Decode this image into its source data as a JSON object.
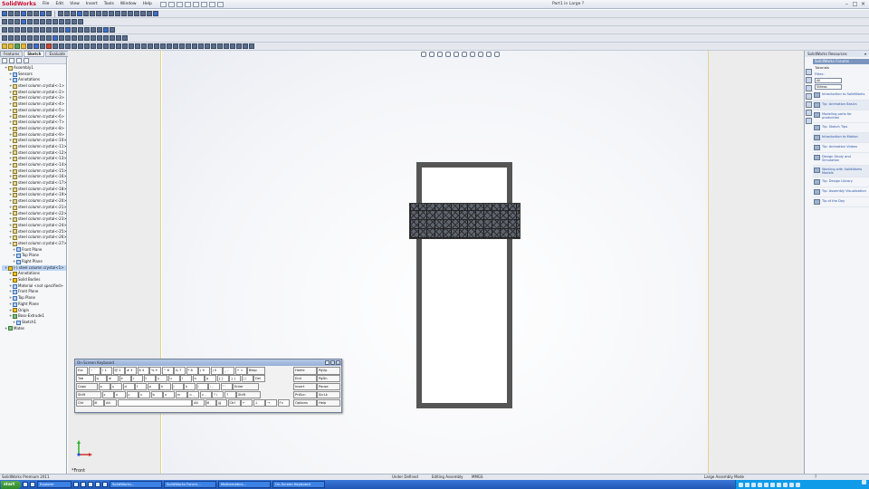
{
  "app": {
    "logo": "SolidWorks",
    "document_title": "Part1 in Large ?",
    "menus": [
      "File",
      "Edit",
      "View",
      "Insert",
      "Tools",
      "Window",
      "Help"
    ]
  },
  "command_tabs": [
    "Features",
    "Sketch",
    "Evaluate",
    "DimXpert",
    "Office Products",
    "Tab",
    "Tab",
    "Tab",
    "Tab",
    "Tab",
    "Tab",
    "Tab",
    "Tab",
    "Tab"
  ],
  "feature_tree": {
    "rows": [
      {
        "label": "Assembly1",
        "depth": 0,
        "icon": "part"
      },
      {
        "label": "Sensors",
        "depth": 1,
        "icon": "plane"
      },
      {
        "label": "Annotations",
        "depth": 1,
        "icon": "plane"
      },
      {
        "label": "steel column crystal<-1>",
        "depth": 1,
        "icon": "part"
      },
      {
        "label": "steel column crystal<-2>",
        "depth": 1,
        "icon": "part"
      },
      {
        "label": "steel column crystal<-3>",
        "depth": 1,
        "icon": "part"
      },
      {
        "label": "steel column crystal<-4>",
        "depth": 1,
        "icon": "part"
      },
      {
        "label": "steel column crystal<-5>",
        "depth": 1,
        "icon": "part"
      },
      {
        "label": "steel column crystal<-6>",
        "depth": 1,
        "icon": "part"
      },
      {
        "label": "steel column crystal<-7>",
        "depth": 1,
        "icon": "part"
      },
      {
        "label": "steel column crystal<-8>",
        "depth": 1,
        "icon": "part"
      },
      {
        "label": "steel column crystal<-9>",
        "depth": 1,
        "icon": "part"
      },
      {
        "label": "steel column crystal<-10>",
        "depth": 1,
        "icon": "part"
      },
      {
        "label": "steel column crystal<-11>",
        "depth": 1,
        "icon": "part"
      },
      {
        "label": "steel column crystal<-12>",
        "depth": 1,
        "icon": "part"
      },
      {
        "label": "steel column crystal<-13>",
        "depth": 1,
        "icon": "part"
      },
      {
        "label": "steel column crystal<-14>",
        "depth": 1,
        "icon": "part"
      },
      {
        "label": "steel column crystal<-15>",
        "depth": 1,
        "icon": "part"
      },
      {
        "label": "steel column crystal<-16>",
        "depth": 1,
        "icon": "part"
      },
      {
        "label": "steel column crystal<-17>",
        "depth": 1,
        "icon": "part"
      },
      {
        "label": "steel column crystal<-18>",
        "depth": 1,
        "icon": "part"
      },
      {
        "label": "steel column crystal<-19>",
        "depth": 1,
        "icon": "part"
      },
      {
        "label": "steel column crystal<-20>",
        "depth": 1,
        "icon": "part"
      },
      {
        "label": "steel column crystal<-21>",
        "depth": 1,
        "icon": "part"
      },
      {
        "label": "steel column crystal<-22>",
        "depth": 1,
        "icon": "part"
      },
      {
        "label": "steel column crystal<-23>",
        "depth": 1,
        "icon": "part"
      },
      {
        "label": "steel column crystal<-24>",
        "depth": 1,
        "icon": "part"
      },
      {
        "label": "steel column crystal<-25>",
        "depth": 1,
        "icon": "part"
      },
      {
        "label": "steel column crystal<-26>",
        "depth": 1,
        "icon": "part"
      },
      {
        "label": "steel column crystal<-27>",
        "depth": 1,
        "icon": "part"
      },
      {
        "label": "Front Plane",
        "depth": 2,
        "icon": "plane"
      },
      {
        "label": "Top Plane",
        "depth": 2,
        "icon": "plane"
      },
      {
        "label": "Right Plane",
        "depth": 2,
        "icon": "plane"
      },
      {
        "label": "(-) steel column crystal<1>",
        "depth": 0,
        "icon": "warn",
        "selected": true
      },
      {
        "label": "Annotations",
        "depth": 1,
        "icon": "warn"
      },
      {
        "label": "Solid Bodies",
        "depth": 1,
        "icon": "warn"
      },
      {
        "label": "Material <not specified>",
        "depth": 1,
        "icon": "plane"
      },
      {
        "label": "Front Plane",
        "depth": 1,
        "icon": "plane"
      },
      {
        "label": "Top Plane",
        "depth": 1,
        "icon": "plane"
      },
      {
        "label": "Right Plane",
        "depth": 1,
        "icon": "plane"
      },
      {
        "label": "Origin",
        "depth": 1,
        "icon": "warn"
      },
      {
        "label": "Boss-Extrude1",
        "depth": 1,
        "icon": "mate"
      },
      {
        "label": "Sketch1",
        "depth": 2,
        "icon": "plane"
      },
      {
        "label": "Mates",
        "depth": 0,
        "icon": "mate"
      }
    ]
  },
  "viewport": {
    "view_label": "*Front"
  },
  "keyboard": {
    "title": "On-Screen Keyboard",
    "rows": [
      [
        "Esc",
        "~ `",
        "! 1",
        "@ 2",
        "# 3",
        "$ 4",
        "% 5",
        "^ 6",
        "& 7",
        "* 8",
        "( 9",
        ") 0",
        "_ -",
        "+ =",
        "Bksp"
      ],
      [
        "Tab",
        "q",
        "w",
        "e",
        "r",
        "t",
        "y",
        "u",
        "i",
        "o",
        "p",
        "{ [",
        "} ]",
        "| \\",
        "Del"
      ],
      [
        "Caps",
        "a",
        "s",
        "d",
        "f",
        "g",
        "h",
        "j",
        "k",
        "l",
        ": ;",
        "\" '",
        "Enter"
      ],
      [
        "Shift",
        "z",
        "x",
        "c",
        "v",
        "b",
        "n",
        "m",
        "< ,",
        "> .",
        "? /",
        "↑",
        "Shift"
      ],
      [
        "Ctrl",
        "⊞",
        "Alt",
        "",
        "Alt",
        "⊞",
        "▤",
        "Ctrl",
        "←",
        "↓",
        "→",
        "Fn"
      ]
    ],
    "nav": [
      [
        "Home",
        "PgUp"
      ],
      [
        "End",
        "PgDn"
      ],
      [
        "Insert",
        "Pause"
      ],
      [
        "PrtScn",
        "ScrLk"
      ],
      [
        "Options",
        "Help"
      ]
    ]
  },
  "task_pane": {
    "title": "SolidWorks Resources",
    "header": "SolidWorks Forums",
    "section": "Tutorials",
    "filter_label": "Filter:",
    "dropdown_1": "All",
    "dropdown_2": "Videos",
    "items": [
      "Introduction to SolidWorks",
      "Tip: Animation Basics",
      "Modeling parts for production",
      "Tip: Sketch Tips",
      "Introduction to Motion",
      "Tip: Animation Videos",
      "Design Study and Simulation",
      "Working with SolidWorks Models",
      "Tip: Design Library",
      "Tip: Assembly Visualization"
    ],
    "last": "Tip of the Day"
  },
  "status": {
    "left": "SolidWorks Premium 2011",
    "m1": "Under Defined",
    "m2": "Editing Assembly",
    "m3": "MMGS",
    "r1": "Large Assembly Mode",
    "r2": "?"
  },
  "taskbar": {
    "start": "start",
    "tasks": [
      "Explorer",
      "SolidWorks...",
      "SolidWorks Forum...",
      "Mathematics...",
      "On-Screen Keyboard"
    ],
    "clock": ""
  },
  "colors": {
    "model_edge": "#555555",
    "mesh": "#5e6470",
    "selection": "#bfd6f5",
    "taskbar": "#1f56b5"
  }
}
